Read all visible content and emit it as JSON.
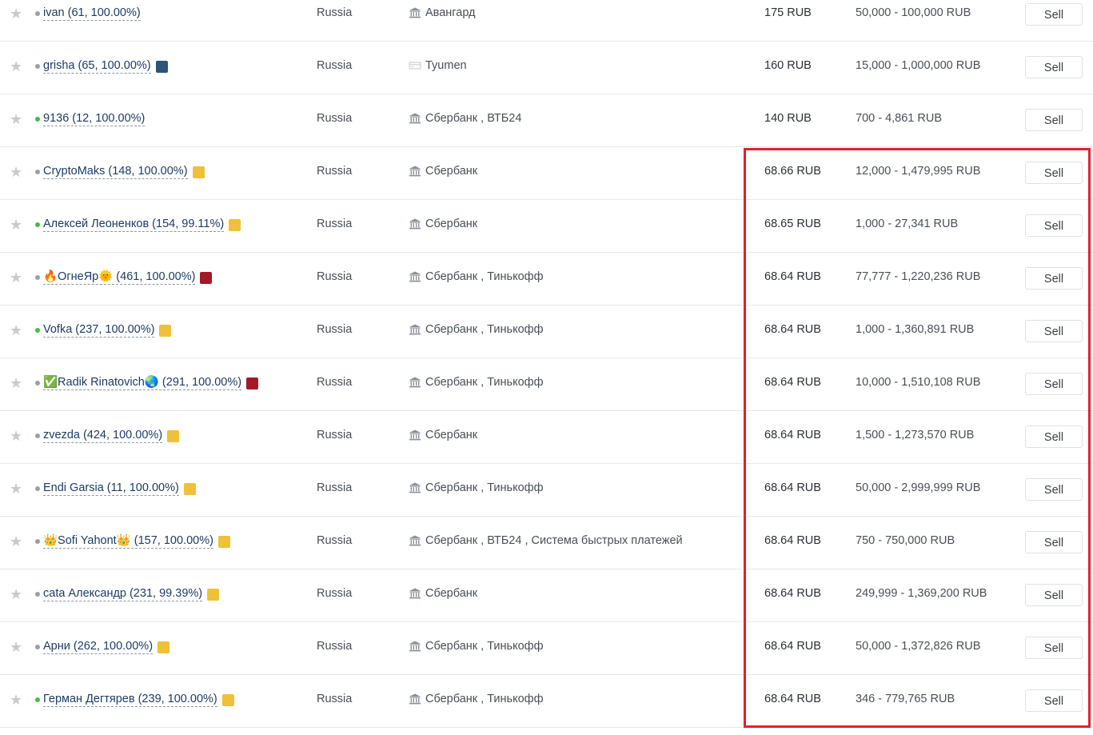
{
  "colors": {
    "online": "#48b94a",
    "offline": "#9aa0a6",
    "badge_gold": "#f0c038",
    "badge_navy": "#2c5577",
    "badge_red": "#a31a26",
    "highlight": "#e3202c"
  },
  "rows": [
    {
      "trader": "ivan (61, 100.00%)",
      "status": "offline",
      "badge": "",
      "location": "Russia",
      "payment_icon": "bank-icon",
      "payment": "Авангард",
      "price": "175 RUB",
      "limits": "50,000 - 100,000 RUB",
      "action": "Sell"
    },
    {
      "trader": "grisha (65, 100.00%)",
      "status": "offline",
      "badge": "navy",
      "location": "Russia",
      "payment_icon": "card-icon",
      "payment": "Tyumen",
      "price": "160 RUB",
      "limits": "15,000 - 1,000,000 RUB",
      "action": "Sell"
    },
    {
      "trader": "9136 (12, 100.00%)",
      "status": "online",
      "badge": "",
      "location": "Russia",
      "payment_icon": "bank-icon",
      "payment": "Сбербанк , ВТБ24",
      "price": "140 RUB",
      "limits": "700 - 4,861 RUB",
      "action": "Sell"
    },
    {
      "trader": "CryptoMaks (148, 100.00%)",
      "status": "offline",
      "badge": "gold",
      "location": "Russia",
      "payment_icon": "bank-icon",
      "payment": "Сбербанк",
      "price": "68.66 RUB",
      "limits": "12,000 - 1,479,995 RUB",
      "action": "Sell"
    },
    {
      "trader": "Алексей Леоненков (154, 99.11%)",
      "status": "online",
      "badge": "gold",
      "location": "Russia",
      "payment_icon": "bank-icon",
      "payment": "Сбербанк",
      "price": "68.65 RUB",
      "limits": "1,000 - 27,341 RUB",
      "action": "Sell"
    },
    {
      "trader": "🔥ОгнеЯр🌞 (461, 100.00%)",
      "status": "offline",
      "badge": "red",
      "location": "Russia",
      "payment_icon": "bank-icon",
      "payment": "Сбербанк , Тинькофф",
      "price": "68.64 RUB",
      "limits": "77,777 - 1,220,236 RUB",
      "action": "Sell"
    },
    {
      "trader": "Vofka (237, 100.00%)",
      "status": "online",
      "badge": "gold",
      "location": "Russia",
      "payment_icon": "bank-icon",
      "payment": "Сбербанк , Тинькофф",
      "price": "68.64 RUB",
      "limits": "1,000 - 1,360,891 RUB",
      "action": "Sell"
    },
    {
      "trader": "✅Radik Rinatovich🌏 (291, 100.00%)",
      "status": "offline",
      "badge": "red",
      "location": "Russia",
      "payment_icon": "bank-icon",
      "payment": "Сбербанк , Тинькофф",
      "price": "68.64 RUB",
      "limits": "10,000 - 1,510,108 RUB",
      "action": "Sell"
    },
    {
      "trader": "zvezda (424, 100.00%)",
      "status": "offline",
      "badge": "gold",
      "location": "Russia",
      "payment_icon": "bank-icon",
      "payment": "Сбербанк",
      "price": "68.64 RUB",
      "limits": "1,500 - 1,273,570 RUB",
      "action": "Sell"
    },
    {
      "trader": "Endi Garsia (11, 100.00%)",
      "status": "offline",
      "badge": "gold",
      "location": "Russia",
      "payment_icon": "bank-icon",
      "payment": "Сбербанк , Тинькофф",
      "price": "68.64 RUB",
      "limits": "50,000 - 2,999,999 RUB",
      "action": "Sell"
    },
    {
      "trader": "👑Sofi Yahont👑 (157, 100.00%)",
      "status": "offline",
      "badge": "gold",
      "location": "Russia",
      "payment_icon": "bank-icon",
      "payment": "Сбербанк , ВТБ24 , Система быстрых платежей",
      "price": "68.64 RUB",
      "limits": "750 - 750,000 RUB",
      "action": "Sell"
    },
    {
      "trader": "cata Александр (231, 99.39%)",
      "status": "offline",
      "badge": "gold",
      "location": "Russia",
      "payment_icon": "bank-icon",
      "payment": "Сбербанк",
      "price": "68.64 RUB",
      "limits": "249,999 - 1,369,200 RUB",
      "action": "Sell"
    },
    {
      "trader": "Арни (262, 100.00%)",
      "status": "offline",
      "badge": "gold",
      "location": "Russia",
      "payment_icon": "bank-icon",
      "payment": "Сбербанк , Тинькофф",
      "price": "68.64 RUB",
      "limits": "50,000 - 1,372,826 RUB",
      "action": "Sell"
    },
    {
      "trader": "Герман Дегтярев (239, 100.00%)",
      "status": "online",
      "badge": "gold",
      "location": "Russia",
      "payment_icon": "bank-icon",
      "payment": "Сбербанк , Тинькофф",
      "price": "68.64 RUB",
      "limits": "346 - 779,765 RUB",
      "action": "Sell"
    }
  ]
}
